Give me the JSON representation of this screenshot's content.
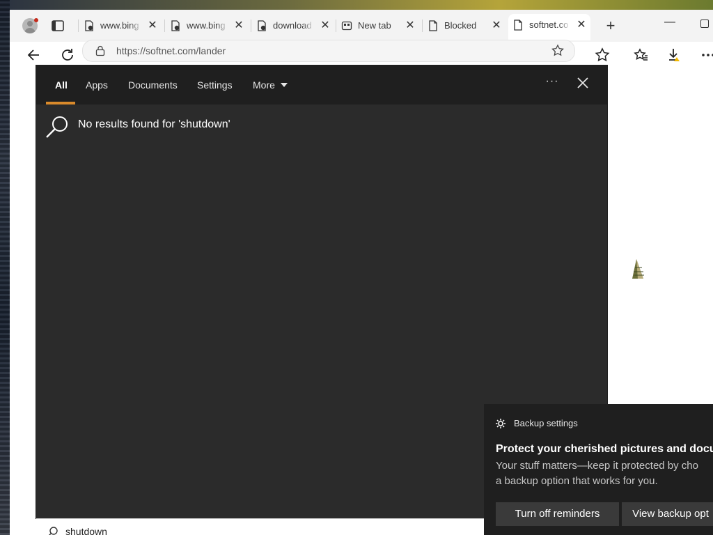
{
  "browser": {
    "tabs": [
      {
        "label": "www.bing",
        "icon": "page-icon"
      },
      {
        "label": "www.bing",
        "icon": "page-icon"
      },
      {
        "label": "download",
        "icon": "page-icon"
      },
      {
        "label": "New tab",
        "icon": "newtab-icon"
      },
      {
        "label": "Blocked",
        "icon": "page-icon"
      },
      {
        "label": "softnet.co",
        "icon": "page-icon",
        "active": true
      }
    ],
    "address": {
      "url": "https://softnet.com/lander"
    }
  },
  "search": {
    "tabs": [
      "All",
      "Apps",
      "Documents",
      "Settings",
      "More"
    ],
    "active_tab": "All",
    "no_results": "No results found for 'shutdown'",
    "query": "shutdown"
  },
  "toast": {
    "app_name": "Backup settings",
    "title": "Protect your cherished pictures and docum",
    "body_line1": "Your stuff matters—keep it protected by cho",
    "body_line2": "a backup option that works for you.",
    "btn_primary": "Turn off reminders",
    "btn_secondary": "View backup opt"
  },
  "colors": {
    "accent": "#d98a2b",
    "panel": "#2b2b2b",
    "toast": "#1f1f1f"
  }
}
